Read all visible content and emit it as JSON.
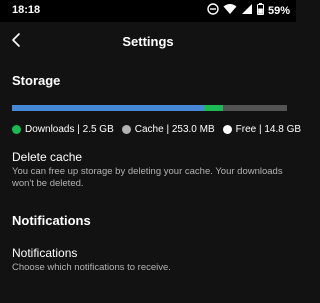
{
  "status_bar": {
    "time": "18:18",
    "icons": [
      "do-not-disturb-icon",
      "wifi-icon",
      "cell-signal-icon",
      "battery-icon"
    ],
    "battery": "59%"
  },
  "header": {
    "title": "Settings",
    "back_icon": "chevron-left-icon"
  },
  "storage": {
    "heading": "Storage",
    "usage": [
      {
        "name": "Downloads",
        "value": "2.5 GB",
        "label": "Downloads | 2.5 GB",
        "color": "#4687d6",
        "fraction": 0.699
      },
      {
        "name": "Cache",
        "value": "253.0 MB",
        "label": "Cache | 253.0 MB",
        "color": "#1db954",
        "fraction": 0.069
      },
      {
        "name": "Free",
        "value": "14.8 GB",
        "label": "Free | 14.8 GB",
        "color": "#535353",
        "fraction": 0.232
      }
    ],
    "legend_dot_colors": [
      "#1db954",
      "#b3b3b3",
      "#ffffff"
    ]
  },
  "delete_cache": {
    "title": "Delete cache",
    "description": "You can free up storage by deleting your cache. Your downloads won't be deleted."
  },
  "notifications": {
    "heading": "Notifications",
    "item_title": "Notifications",
    "item_description": "Choose which notifications to receive."
  }
}
